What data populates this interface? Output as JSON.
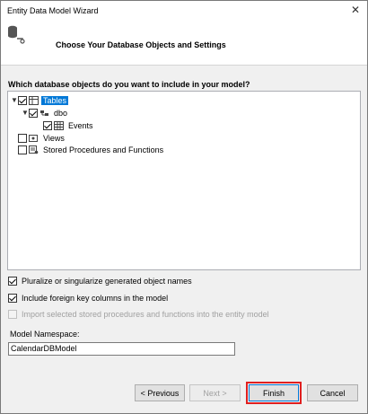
{
  "window": {
    "title": "Entity Data Model Wizard"
  },
  "banner": {
    "title": "Choose Your Database Objects and Settings"
  },
  "question": "Which database objects do you want to include in your model?",
  "tree": [
    {
      "label": "Tables",
      "checked": true,
      "expanded": true,
      "selected": true,
      "icon": "tables-icon"
    },
    {
      "label": "dbo",
      "checked": true,
      "expanded": true,
      "icon": "schema-icon"
    },
    {
      "label": "Events",
      "checked": true,
      "icon": "table-grid-icon"
    },
    {
      "label": "Views",
      "checked": false,
      "icon": "views-icon"
    },
    {
      "label": "Stored Procedures and Functions",
      "checked": false,
      "icon": "stored-procedure-icon"
    }
  ],
  "options": {
    "pluralize": {
      "label": "Pluralize or singularize generated object names",
      "checked": true
    },
    "foreign_keys": {
      "label": "Include foreign key columns in the model",
      "checked": true
    },
    "import_sprocs": {
      "label": "Import selected stored procedures and functions into the entity model",
      "checked": false,
      "disabled": true
    }
  },
  "namespace": {
    "label": "Model Namespace:",
    "value": "CalendarDBModel"
  },
  "buttons": {
    "previous": "< Previous",
    "next": "Next >",
    "finish": "Finish",
    "cancel": "Cancel"
  },
  "colors": {
    "selection": "#0078d7",
    "highlight_outline": "#e02020"
  }
}
